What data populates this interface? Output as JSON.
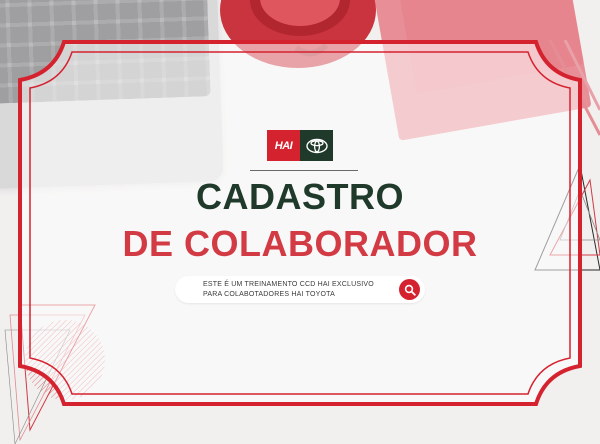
{
  "logo": {
    "brand_text": "HAI",
    "partner_icon": "toyota-logo-icon"
  },
  "heading": {
    "line1": "CADASTRO",
    "line2": "DE COLABORADOR"
  },
  "search": {
    "line1": "ESTE É UM TREINAMENTO CCD HAI EXCLUSIVO",
    "line2": "PARA COLABOTADORES HAI TOYOTA",
    "icon": "search-icon"
  },
  "colors": {
    "brand_red": "#d5222f",
    "brand_green": "#1f3a2b",
    "title_red": "#d23a44"
  }
}
